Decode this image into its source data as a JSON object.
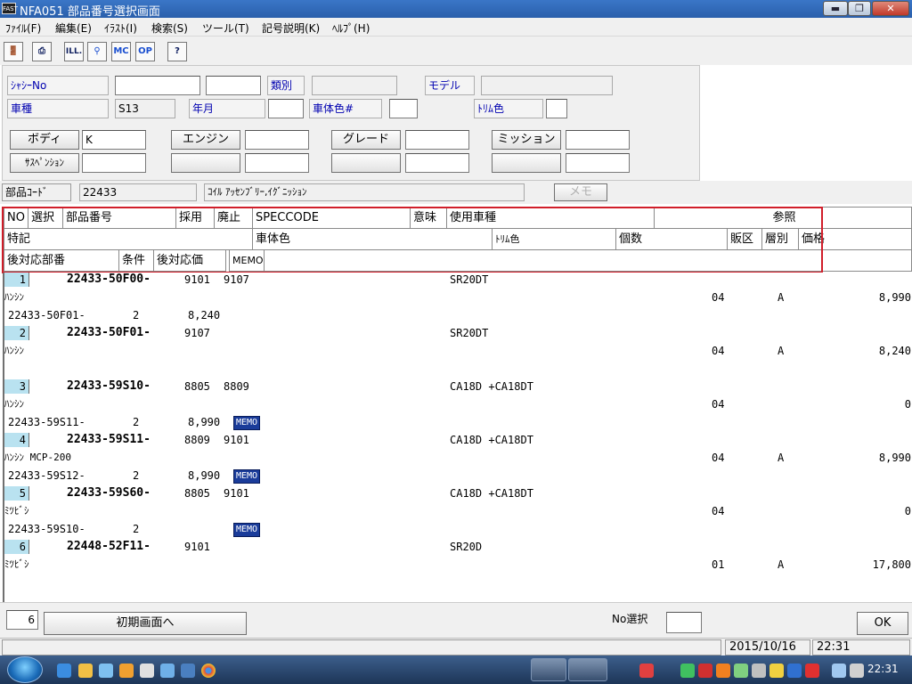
{
  "window": {
    "app_icon": "FAST",
    "title": "NFA051 部品番号選択画面"
  },
  "menu": [
    "ﾌｧｲﾙ(F)",
    "編集(E)",
    "ｲﾗｽﾄ(I)",
    "検索(S)",
    "ツール(T)",
    "記号説明(K)",
    "ﾍﾙﾌﾟ(H)"
  ],
  "toolbar": {
    "icons": [
      "exit-icon",
      "print-icon",
      "illustration-icon",
      "tree-icon",
      "mc-icon",
      "op-icon",
      "help-icon"
    ],
    "ill_label": "ILL.",
    "mc_label": "MC",
    "op_label": "OP"
  },
  "form": {
    "chassis_label": "ｼｬｼｰNo",
    "chassis_value1": "",
    "chassis_value2": "",
    "class_label": "類別",
    "class_value": "",
    "model_label": "モデル",
    "model_value": "",
    "vehicle_label": "車種",
    "vehicle_value": "S13",
    "year_label": "年月",
    "year_value": "",
    "body_color_label": "車体色#",
    "body_color_value": "",
    "trim_label": "ﾄﾘﾑ色",
    "trim_value": "",
    "body_button": "ボディ",
    "body_value": "K",
    "engine_button": "エンジン",
    "engine_value": "",
    "grade_button": "グレード",
    "grade_value": "",
    "mission_button": "ミッション",
    "mission_value": "",
    "suspension_button": "ｻｽﾍﾟﾝｼｮﾝ",
    "suspension_value": ""
  },
  "parts": {
    "code_label": "部品ｺｰﾄﾞ",
    "code_value": "22433",
    "name_value": "ｺｲﾙ ｱｯｾﾝﾌﾞﾘｰ,ｲｸﾞﾆｯｼｮﾝ",
    "memo_button": "メモ"
  },
  "header": {
    "row1": [
      "NO",
      "選択",
      "部品番号",
      "採用",
      "廃止",
      "SPECCODE",
      "意味",
      "使用車種",
      "参照"
    ],
    "row2": [
      "特記",
      "車体色",
      "ﾄﾘﾑ色",
      "個数",
      "販区",
      "層別",
      "価格"
    ],
    "row3": [
      "後対応部番",
      "条件",
      "後対応価",
      "MEMO"
    ]
  },
  "rows": [
    {
      "no": "1",
      "part": "22433-50F00-",
      "adopt": "9101",
      "abolish": "9107",
      "models": "SR20DT",
      "note": "ﾊﾝｼﾝ",
      "qty": "04",
      "layer": "A",
      "price": "8,990",
      "sub": {
        "part": "22433-50F01-",
        "cond": "2",
        "price": "8,240",
        "memo": false
      }
    },
    {
      "no": "2",
      "part": "22433-50F01-",
      "adopt": "9107",
      "abolish": "",
      "models": "SR20DT",
      "note": "ﾊﾝｼﾝ",
      "qty": "04",
      "layer": "A",
      "price": "8,240",
      "sub": null
    },
    {
      "no": "3",
      "part": "22433-59S10-",
      "adopt": "8805",
      "abolish": "8809",
      "models": "CA18D +CA18DT",
      "note": "ﾊﾝｼﾝ",
      "qty": "04",
      "layer": "",
      "price": "0",
      "sub": {
        "part": "22433-59S11-",
        "cond": "2",
        "price": "8,990",
        "memo": true
      }
    },
    {
      "no": "4",
      "part": "22433-59S11-",
      "adopt": "8809",
      "abolish": "9101",
      "models": "CA18D +CA18DT",
      "note": "ﾊﾝｼﾝ MCP-200",
      "qty": "04",
      "layer": "A",
      "price": "8,990",
      "sub": {
        "part": "22433-59S12-",
        "cond": "2",
        "price": "8,990",
        "memo": true
      }
    },
    {
      "no": "5",
      "part": "22433-59S60-",
      "adopt": "8805",
      "abolish": "9101",
      "models": "CA18D +CA18DT",
      "note": "ﾐﾂﾋﾞｼ",
      "qty": "04",
      "layer": "",
      "price": "0",
      "sub": {
        "part": "22433-59S10-",
        "cond": "2",
        "price": "",
        "memo": true
      }
    },
    {
      "no": "6",
      "part": "22448-52F11-",
      "adopt": "9101",
      "abolish": "",
      "models": "SR20D",
      "note": "ﾐﾂﾋﾞｼ",
      "qty": "01",
      "layer": "A",
      "price": "17,800",
      "sub": null
    }
  ],
  "memo_tag": "MEMO",
  "bottom": {
    "count": "6",
    "init_button": "初期画面へ",
    "no_select_label": "No選択",
    "no_select_value": "",
    "ok_button": "OK"
  },
  "status": {
    "date": "2015/10/16",
    "time": "22:31"
  },
  "taskbar": {
    "clock": "22:31",
    "icons": [
      "start-orb-icon",
      "ie-icon",
      "folder-icon",
      "messenger-icon",
      "media-icon",
      "mail-icon",
      "network-icon",
      "display-icon",
      "chrome-icon"
    ]
  }
}
